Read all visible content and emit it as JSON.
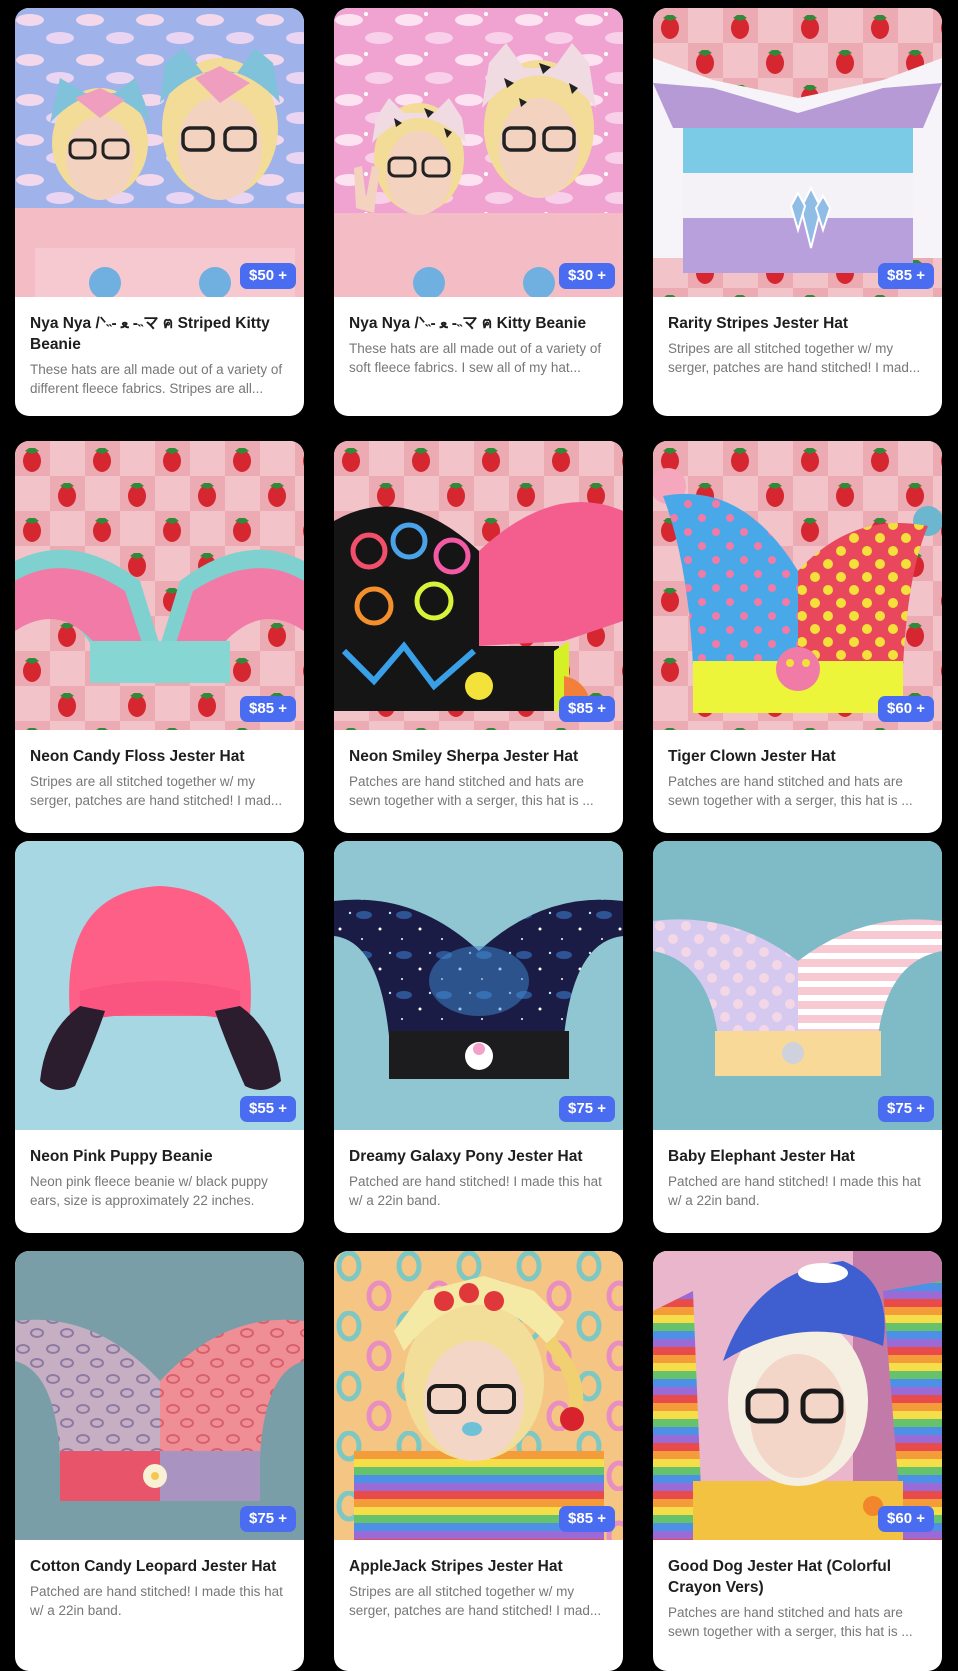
{
  "colors": {
    "page_background": "#000000",
    "card_background": "#ffffff",
    "price_badge": "#4a6cf0",
    "title_text": "#1e1e1e",
    "description_text": "#777777"
  },
  "products": [
    {
      "title": "Nya Nya /ᐠ˵- ﻌ -˵マ ฅ Striped Kitty Beanie",
      "description": "These hats are all made out of a variety of different fleece fabrics. Stripes are all...",
      "price": "$50 +",
      "image_icon": "photo-two-people-striped-kitty-beanies"
    },
    {
      "title": "Nya Nya /ᐠ˵- ﻌ -˵マ ฅ Kitty Beanie",
      "description": "These hats are all made out of a variety of soft fleece fabrics. I sew all of my hat...",
      "price": "$30 +",
      "image_icon": "photo-two-people-cow-print-kitty-beanies"
    },
    {
      "title": "Rarity Stripes Jester Hat",
      "description": "Stripes are all stitched together w/ my serger, patches are hand stitched! I mad...",
      "price": "$85 +",
      "image_icon": "photo-purple-blue-white-striped-jester-hat"
    },
    {
      "title": "Neon Candy Floss Jester Hat",
      "description": "Stripes are all stitched together w/ my serger, patches are hand stitched! I mad...",
      "price": "$85 +",
      "image_icon": "photo-pink-teal-jester-hat"
    },
    {
      "title": "Neon Smiley Sherpa Jester Hat",
      "description": "Patches are hand stitched and hats are sewn together with a serger, this hat is ...",
      "price": "$85 +",
      "image_icon": "photo-smiley-sherpa-jester-hat"
    },
    {
      "title": "Tiger Clown Jester Hat",
      "description": "Patches are hand stitched and hats are sewn together with a serger, this hat is ...",
      "price": "$60 +",
      "image_icon": "photo-polka-dot-tiger-jester-hat"
    },
    {
      "title": "Neon Pink Puppy Beanie",
      "description": "Neon pink fleece beanie w/ black puppy ears, size is approximately 22 inches.",
      "price": "$55 +",
      "image_icon": "photo-neon-pink-puppy-beanie"
    },
    {
      "title": "Dreamy Galaxy Pony Jester Hat",
      "description": "Patched are hand stitched! I made this hat w/ a 22in band.",
      "price": "$75 +",
      "image_icon": "photo-galaxy-pony-jester-hat"
    },
    {
      "title": "Baby Elephant Jester Hat",
      "description": "Patched are hand stitched! I made this hat w/ a 22in band.",
      "price": "$75 +",
      "image_icon": "photo-pastel-elephant-jester-hat"
    },
    {
      "title": "Cotton Candy Leopard Jester Hat",
      "description": "Patched are hand stitched! I made this hat w/ a 22in band.",
      "price": "$75 +",
      "image_icon": "photo-leopard-jester-hat"
    },
    {
      "title": "AppleJack Stripes Jester Hat",
      "description": "Stripes are all stitched together w/ my serger, patches are hand stitched! I mad...",
      "price": "$85 +",
      "image_icon": "photo-person-applejack-jester-hat"
    },
    {
      "title": "Good Dog Jester Hat (Colorful Crayon Vers)",
      "description": "Patches are hand stitched and hats are sewn together with a serger, this hat is ...",
      "price": "$60 +",
      "image_icon": "photo-person-good-dog-jester-hat"
    }
  ]
}
